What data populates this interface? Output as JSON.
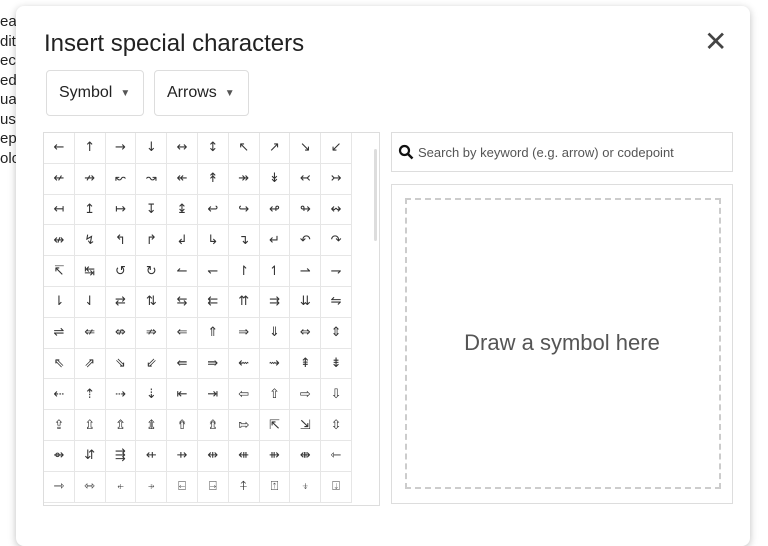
{
  "background_text": [
    "ea",
    "dit",
    "ec",
    "ed",
    "ua",
    "us",
    "epi",
    "olo"
  ],
  "dialog": {
    "title": "Insert special characters",
    "close_label": "✕",
    "category_dropdown": "Symbol",
    "subcategory_dropdown": "Arrows",
    "search_placeholder": "Search by keyword (e.g. arrow) or codepoint",
    "draw_prompt": "Draw a symbol here"
  },
  "symbols": [
    "←",
    "↑",
    "→",
    "↓",
    "↔",
    "↕",
    "↖",
    "↗",
    "↘",
    "↙",
    "↚",
    "↛",
    "↜",
    "↝",
    "↞",
    "↟",
    "↠",
    "↡",
    "↢",
    "↣",
    "↤",
    "↥",
    "↦",
    "↧",
    "↨",
    "↩",
    "↪",
    "↫",
    "↬",
    "↭",
    "↮",
    "↯",
    "↰",
    "↱",
    "↲",
    "↳",
    "↴",
    "↵",
    "↶",
    "↷",
    "↸",
    "↹",
    "↺",
    "↻",
    "↼",
    "↽",
    "↾",
    "↿",
    "⇀",
    "⇁",
    "⇂",
    "⇃",
    "⇄",
    "⇅",
    "⇆",
    "⇇",
    "⇈",
    "⇉",
    "⇊",
    "⇋",
    "⇌",
    "⇍",
    "⇎",
    "⇏",
    "⇐",
    "⇑",
    "⇒",
    "⇓",
    "⇔",
    "⇕",
    "⇖",
    "⇗",
    "⇘",
    "⇙",
    "⇚",
    "⇛",
    "⇜",
    "⇝",
    "⇞",
    "⇟",
    "⇠",
    "⇡",
    "⇢",
    "⇣",
    "⇤",
    "⇥",
    "⇦",
    "⇧",
    "⇨",
    "⇩",
    "⇪",
    "⇫",
    "⇬",
    "⇭",
    "⇮",
    "⇯",
    "⇰",
    "⇱",
    "⇲",
    "⇳",
    "⇴",
    "⇵",
    "⇶",
    "⇷",
    "⇸",
    "⇹",
    "⇺",
    "⇻",
    "⇼",
    "⇽",
    "⇾",
    "⇿",
    "⍅",
    "⍆",
    "⍇",
    "⍈",
    "⍏",
    "⍐",
    "⍖",
    "⍗"
  ]
}
